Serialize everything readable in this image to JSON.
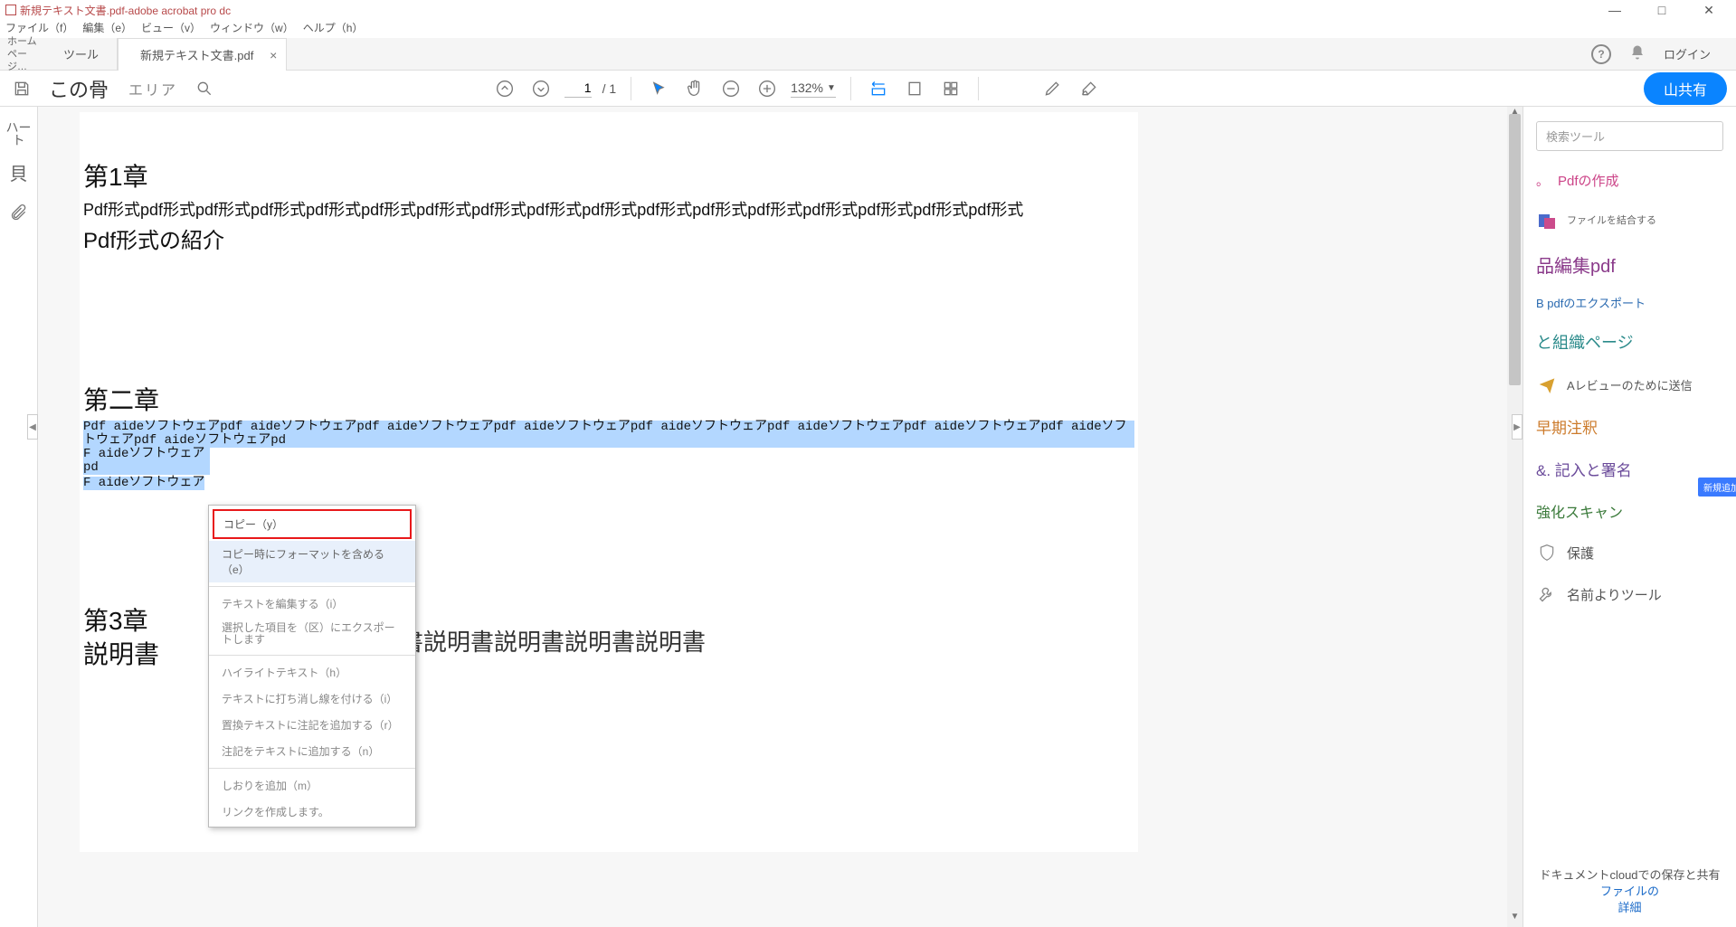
{
  "window": {
    "title": "新規テキスト文書.pdf-adobe acrobat pro dc",
    "min": "—",
    "max": "□",
    "close": "✕"
  },
  "menubar": {
    "file": "ファイル（f）",
    "edit": "編集（e）",
    "view": "ビュー（v）",
    "window": "ウィンドウ（w）",
    "help": "ヘルプ（h）"
  },
  "tabs": {
    "home": "ホームページ…",
    "tools": "ツール",
    "doc": "新規テキスト文書.pdf",
    "login": "ログイン"
  },
  "toolbar": {
    "bone": "この骨",
    "area": "エリア",
    "page_current": "1",
    "page_total": "/ 1",
    "zoom": "132%",
    "share": "山共有"
  },
  "leftrail": {
    "heart": "ハート",
    "shell": "貝"
  },
  "document": {
    "chapter1": "第1章",
    "ch1_body": "Pdf形式pdf形式pdf形式pdf形式pdf形式pdf形式pdf形式pdf形式pdf形式pdf形式pdf形式pdf形式pdf形式pdf形式pdf形式pdf形式pdf形式",
    "ch1_sub": "Pdf形式の紹介",
    "chapter2": "第二章",
    "sel_line1": "Pdf aideソフトウェアpdf aideソフトウェアpdf aideソフトウェアpdf aideソフトウェアpdf aideソフトウェアpdf aideソフトウェアpdf aideソフトウェアpdf aideソフトウェアpdf aideソフトウェアpd",
    "sel_line2": "F aideソフトウェアpd",
    "sel_line3": "F aideソフトウェア",
    "chapter3": "第3章",
    "ch3_sub": "説明書",
    "ch3_right": "目書説明書説明書説明書説明書"
  },
  "context_menu": {
    "copy": "コピー（y）",
    "copy_fmt": "コピー時にフォーマットを含める（e）",
    "edit_text": "テキストを編集する（i）",
    "export_sel": "選択した項目を（区）にエクスポートします",
    "highlight": "ハイライトテキスト（h）",
    "strike": "テキストに打ち消し線を付ける（i）",
    "replace_note": "置換テキストに注記を追加する（r）",
    "add_note": "注記をテキストに追加する（n）",
    "bookmark": "しおりを追加（m）",
    "link": "リンクを作成します。"
  },
  "rightpanel": {
    "search_ph": "検索ツール",
    "create_pdf": "Pdfの作成",
    "combine": "ファイルを結合する",
    "edit_pdf": "品編集pdf",
    "export_pdf": "B pdfのエクスポート",
    "organize": "と組織ページ",
    "send_review": "Aレビューのために送信",
    "badge_new": "新規追加",
    "early_annot": "早期注釈",
    "fill_sign": "&. 記入と署名",
    "enhance_scan": "強化スキャン",
    "protect": "保護",
    "more_tools": "名前よりツール",
    "footer1": "ドキュメントcloudでの保存と共有",
    "footer2": "ファイルの",
    "footer3": "詳細"
  }
}
